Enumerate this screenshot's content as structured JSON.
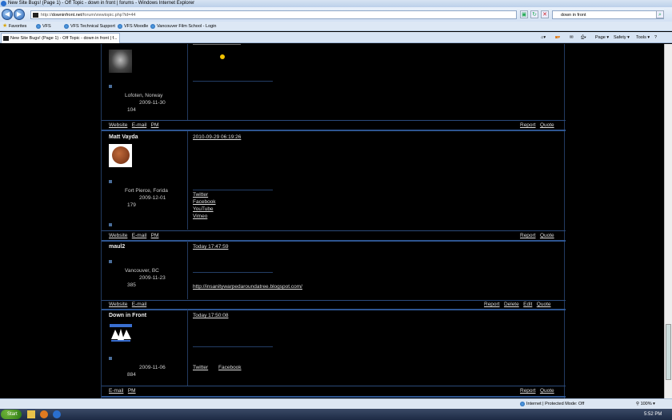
{
  "window": {
    "title": "New Site Bugs! (Page 1) - Off Topic - down in front | forums - Windows Internet Explorer"
  },
  "address": {
    "url_prefix": "http://",
    "url_domain": "downinfront.net",
    "url_path": "/forum/viewtopic.php?id=44",
    "search_value": "down in front"
  },
  "favorites": {
    "label": "Favorites",
    "links": [
      "VFS",
      "VFS Technical Support",
      "VFS Moodle",
      "Vancouver Film School - Login"
    ]
  },
  "tab": {
    "label": "New Site Bugs! (Page 1) - Off Topic - down in front | f..."
  },
  "commandbar": {
    "page": "Page ▾",
    "safety": "Safety ▾",
    "tools": "Tools ▾",
    "help": "?"
  },
  "posts": [
    {
      "location": "Lofoten, Norway",
      "registered": "2009-11-30",
      "count": "104",
      "footer_left": [
        "Website",
        "E-mail",
        "PM"
      ],
      "footer_right": [
        "Report",
        "Quote"
      ]
    },
    {
      "author": "Matt Vayda",
      "date": "2010-09-29 06:19:26",
      "location": "Fort Pierce, Forida",
      "registered": "2009-12-01",
      "count": "179",
      "sig_links": [
        "Twitter",
        "Facebook",
        "YouTube",
        "Vimeo"
      ],
      "footer_left": [
        "Website",
        "E-mail",
        "PM"
      ],
      "footer_right": [
        "Report",
        "Quote"
      ]
    },
    {
      "author": "maul2",
      "date": "Today 17:47:59",
      "location": "Vancouver, BC",
      "registered": "2009-11-23",
      "count": "385",
      "sig_link": "http://insanitywarpedaroundatree.blogspot.com/",
      "footer_left": [
        "Website",
        "E-mail"
      ],
      "footer_right": [
        "Report",
        "Delete",
        "Edit",
        "Quote"
      ]
    },
    {
      "author": "Down in Front",
      "date": "Today 17:50:08",
      "registered": "2009-11-06",
      "count": "884",
      "sig_links": [
        "Twitter",
        "Facebook"
      ],
      "footer_left": [
        "E-mail",
        "PM"
      ],
      "footer_right": [
        "Report",
        "Quote"
      ]
    }
  ],
  "statusbar": {
    "zone": "Internet | Protected Mode: Off",
    "zoom": "100%"
  },
  "taskbar": {
    "start": "Start",
    "clock": "5:52 PM"
  }
}
